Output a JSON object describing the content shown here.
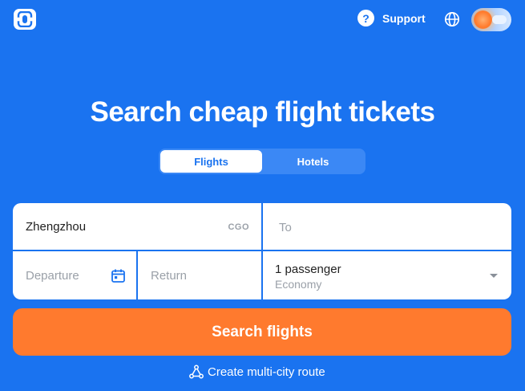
{
  "header": {
    "support_label": "Support",
    "support_icon": "question-icon",
    "language_icon": "globe-icon",
    "theme_icon": "sun-cloud-icon"
  },
  "hero": {
    "title": "Search cheap flight tickets"
  },
  "tabs": [
    {
      "label": "Flights",
      "active": true
    },
    {
      "label": "Hotels",
      "active": false
    }
  ],
  "form": {
    "origin": {
      "value": "Zhengzhou",
      "code": "CGO"
    },
    "destination": {
      "placeholder": "To"
    },
    "departure": {
      "placeholder": "Departure",
      "icon": "calendar-icon"
    },
    "return": {
      "placeholder": "Return"
    },
    "passengers": {
      "count_label": "1 passenger",
      "class_label": "Economy"
    }
  },
  "search_button": {
    "label": "Search flights"
  },
  "multi_city": {
    "label": "Create multi-city route",
    "icon": "route-icon"
  },
  "colors": {
    "background": "#1a73f0",
    "accent": "#ff7a2e",
    "tab_container": "#3b88f5"
  }
}
